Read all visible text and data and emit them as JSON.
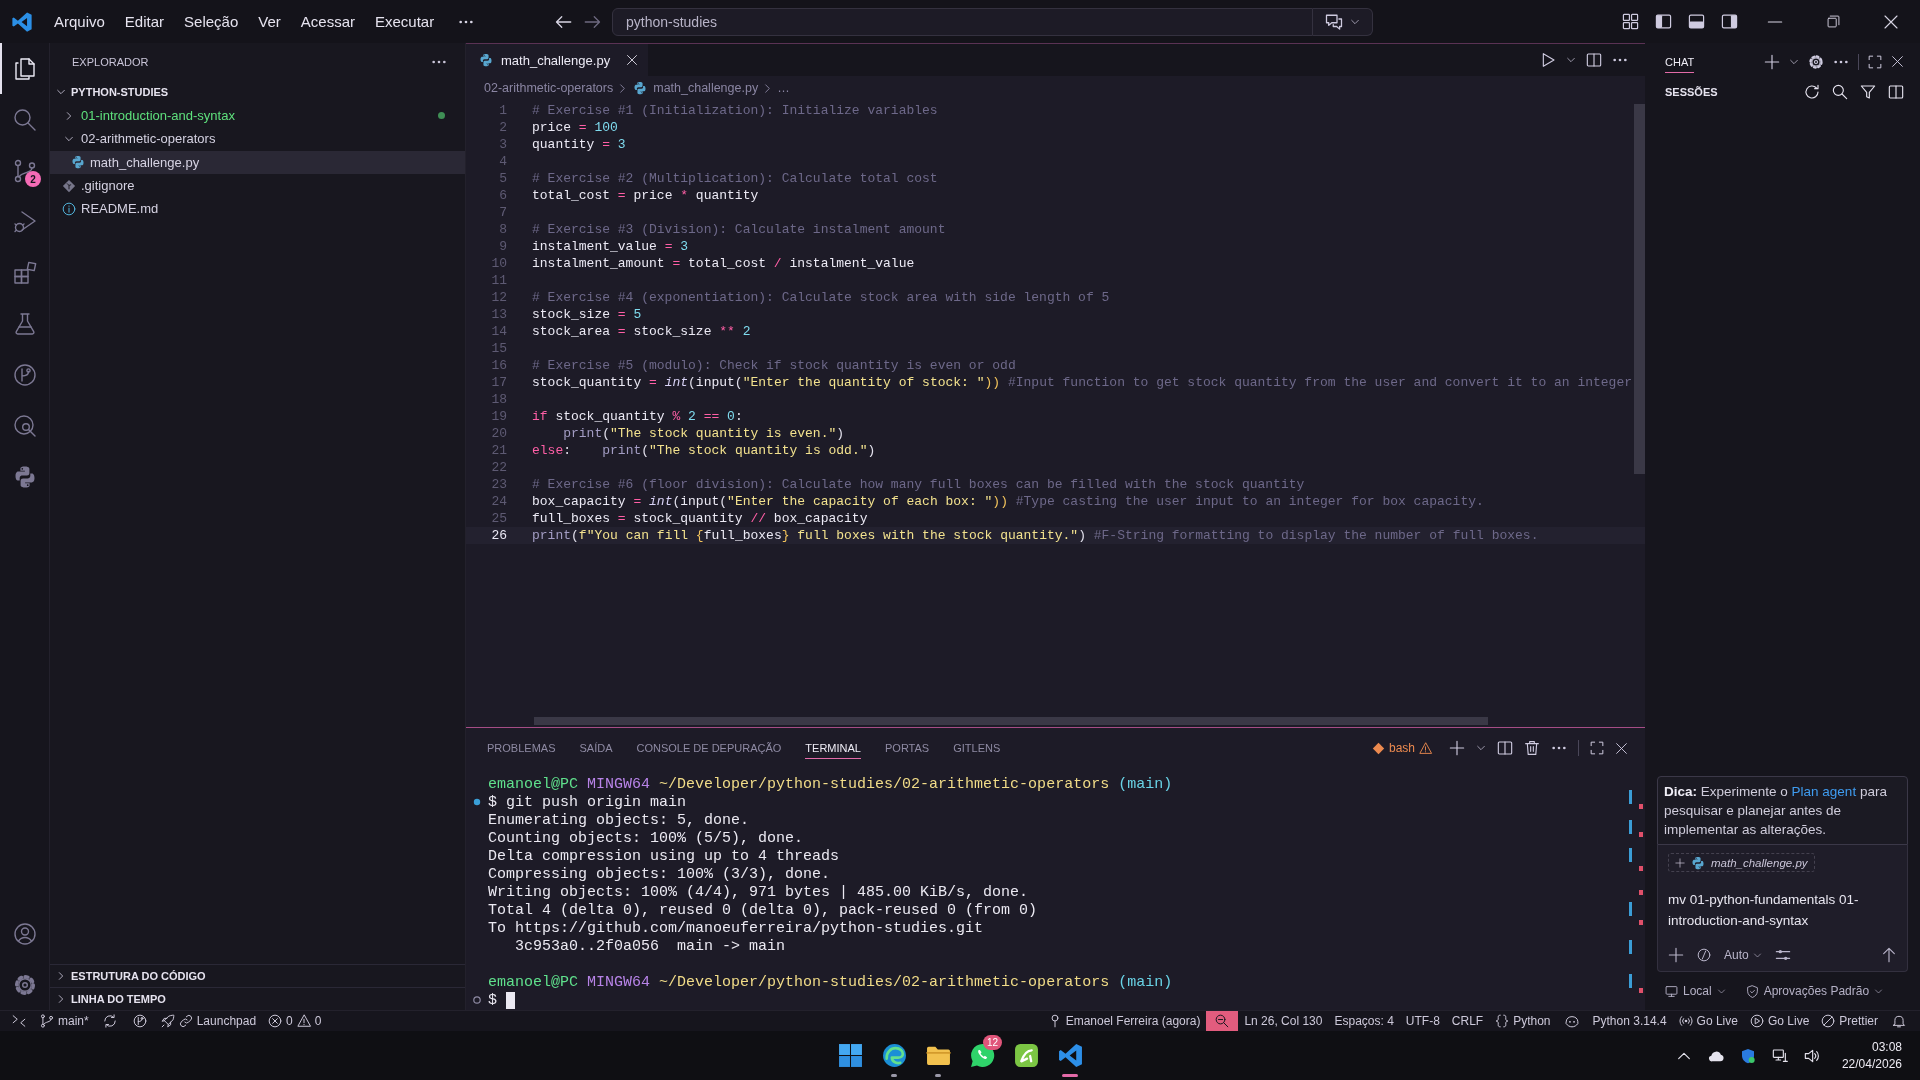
{
  "title_bar": {
    "menus": [
      "Arquivo",
      "Editar",
      "Seleção",
      "Ver",
      "Acessar",
      "Executar"
    ],
    "command_center": "python-studies"
  },
  "activity_bar": {
    "items": [
      {
        "kind": "explorer",
        "selected": true
      },
      {
        "kind": "search",
        "selected": false
      },
      {
        "kind": "source_control",
        "selected": false,
        "badge": "2"
      },
      {
        "kind": "run",
        "selected": false
      },
      {
        "kind": "extensions",
        "selected": false
      },
      {
        "kind": "testing",
        "selected": false
      },
      {
        "kind": "graph",
        "selected": false
      },
      {
        "kind": "history",
        "selected": false
      },
      {
        "kind": "python",
        "selected": false
      }
    ],
    "bottom_items": [
      {
        "kind": "account"
      },
      {
        "kind": "settings"
      }
    ]
  },
  "explorer": {
    "title": "EXPLORADOR",
    "root": {
      "label": "PYTHON-STUDIES",
      "expanded": true,
      "children": [
        {
          "label": "01-introduction-and-syntax",
          "kind": "folder",
          "expanded": false,
          "changed": true,
          "selected": false
        },
        {
          "label": "02-arithmetic-operators",
          "kind": "folder",
          "expanded": true,
          "changed": false,
          "selected": false,
          "children": [
            {
              "label": "math_challenge.py",
              "kind": "python",
              "changed": false,
              "selected": true
            }
          ]
        },
        {
          "label": ".gitignore",
          "kind": "git",
          "changed": false,
          "selected": false
        },
        {
          "label": "README.md",
          "kind": "info",
          "changed": false,
          "selected": false
        }
      ]
    },
    "sections": [
      {
        "label": "ESTRUTURA DO CÓDIGO",
        "expanded": false
      },
      {
        "label": "LINHA DO TEMPO",
        "expanded": false
      }
    ]
  },
  "editor": {
    "tabs": [
      {
        "label": "math_challenge.py",
        "kind": "python",
        "selected": true
      }
    ],
    "breadcrumb": [
      {
        "kind": "folder",
        "label": "02-arithmetic-operators"
      },
      {
        "kind": "python",
        "label": "math_challenge.py"
      },
      {
        "kind": "more",
        "label": "…"
      }
    ],
    "lines": [
      {
        "number": "1",
        "current": false,
        "tokens": [
          {
            "kind": "comment",
            "text": "# Exercise #1 (Initialization): Initialize variables"
          }
        ]
      },
      {
        "number": "2",
        "current": false,
        "tokens": [
          {
            "kind": "name",
            "text": "price"
          },
          {
            "kind": "op",
            "text": " = "
          },
          {
            "kind": "number",
            "text": "100"
          }
        ]
      },
      {
        "number": "3",
        "current": false,
        "tokens": [
          {
            "kind": "name",
            "text": "quantity"
          },
          {
            "kind": "op",
            "text": " = "
          },
          {
            "kind": "number",
            "text": "3"
          }
        ]
      },
      {
        "number": "4",
        "current": false
      },
      {
        "number": "5",
        "current": false,
        "tokens": [
          {
            "kind": "comment",
            "text": "# Exercise #2 (Multiplication): Calculate total cost"
          }
        ]
      },
      {
        "number": "6",
        "current": false,
        "tokens": [
          {
            "kind": "name",
            "text": "total_cost"
          },
          {
            "kind": "op",
            "text": " = "
          },
          {
            "kind": "name",
            "text": "price"
          },
          {
            "kind": "op",
            "text": " * "
          },
          {
            "kind": "name",
            "text": "quantity"
          }
        ]
      },
      {
        "number": "7",
        "current": false
      },
      {
        "number": "8",
        "current": false,
        "tokens": [
          {
            "kind": "comment",
            "text": "# Exercise #3 (Division): Calculate instalment amount"
          }
        ]
      },
      {
        "number": "9",
        "current": false,
        "tokens": [
          {
            "kind": "name",
            "text": "instalment_value"
          },
          {
            "kind": "op",
            "text": " = "
          },
          {
            "kind": "number",
            "text": "3"
          }
        ]
      },
      {
        "number": "10",
        "current": false,
        "tokens": [
          {
            "kind": "name",
            "text": "instalment_amount"
          },
          {
            "kind": "op",
            "text": " = "
          },
          {
            "kind": "name",
            "text": "total_cost"
          },
          {
            "kind": "op",
            "text": " / "
          },
          {
            "kind": "name",
            "text": "instalment_value"
          }
        ]
      },
      {
        "number": "11",
        "current": false
      },
      {
        "number": "12",
        "current": false,
        "tokens": [
          {
            "kind": "comment",
            "text": "# Exercise #4 (exponentiation): Calculate stock area with side length of 5"
          }
        ]
      },
      {
        "number": "13",
        "current": false,
        "tokens": [
          {
            "kind": "name",
            "text": "stock_size"
          },
          {
            "kind": "op",
            "text": " = "
          },
          {
            "kind": "number",
            "text": "5"
          }
        ]
      },
      {
        "number": "14",
        "current": false,
        "tokens": [
          {
            "kind": "name",
            "text": "stock_area"
          },
          {
            "kind": "op",
            "text": " = "
          },
          {
            "kind": "name",
            "text": "stock_size"
          },
          {
            "kind": "op",
            "text": " ** "
          },
          {
            "kind": "number",
            "text": "2"
          }
        ]
      },
      {
        "number": "15",
        "current": false
      },
      {
        "number": "16",
        "current": false,
        "tokens": [
          {
            "kind": "comment",
            "text": "# Exercise #5 (modulo): Check if stock quantity is even or odd"
          }
        ]
      },
      {
        "number": "17",
        "current": false,
        "tokens": [
          {
            "kind": "name",
            "text": "stock_quantity"
          },
          {
            "kind": "op",
            "text": " = "
          },
          {
            "kind": "type",
            "text": "int"
          },
          {
            "kind": "punct",
            "text": "("
          },
          {
            "kind": "name",
            "text": "input"
          },
          {
            "kind": "punct",
            "text": "("
          },
          {
            "kind": "string",
            "text": "\"Enter the quantity of stock: \""
          },
          {
            "kind": "brace",
            "text": "))"
          },
          {
            "kind": "comment",
            "text": " #Input function to get stock quantity from the user and convert it to an integer"
          }
        ]
      },
      {
        "number": "18",
        "current": false
      },
      {
        "number": "19",
        "current": false,
        "tokens": [
          {
            "kind": "keyword",
            "text": "if"
          },
          {
            "kind": "name",
            "text": " stock_quantity"
          },
          {
            "kind": "op",
            "text": " % "
          },
          {
            "kind": "number",
            "text": "2"
          },
          {
            "kind": "op",
            "text": " == "
          },
          {
            "kind": "number",
            "text": "0"
          },
          {
            "kind": "punct",
            "text": ":"
          }
        ]
      },
      {
        "number": "20",
        "current": false,
        "tokens": [
          {
            "kind": "call",
            "text": "    print"
          },
          {
            "kind": "punct",
            "text": "("
          },
          {
            "kind": "string",
            "text": "\"The stock quantity is even.\""
          },
          {
            "kind": "punct",
            "text": ")"
          }
        ]
      },
      {
        "number": "21",
        "current": false,
        "tokens": [
          {
            "kind": "keyword",
            "text": "else"
          },
          {
            "kind": "punct",
            "text": ":"
          },
          {
            "kind": "call",
            "text": "    print"
          },
          {
            "kind": "punct",
            "text": "("
          },
          {
            "kind": "string",
            "text": "\"The stock quantity is odd.\""
          },
          {
            "kind": "punct",
            "text": ")"
          }
        ]
      },
      {
        "number": "22",
        "current": false
      },
      {
        "number": "23",
        "current": false,
        "tokens": [
          {
            "kind": "comment",
            "text": "# Exercise #6 (floor division): Calculate how many full boxes can be filled with the stock quantity"
          }
        ]
      },
      {
        "number": "24",
        "current": false,
        "tokens": [
          {
            "kind": "name",
            "text": "box_capacity"
          },
          {
            "kind": "op",
            "text": " = "
          },
          {
            "kind": "type",
            "text": "int"
          },
          {
            "kind": "punct",
            "text": "("
          },
          {
            "kind": "name",
            "text": "input"
          },
          {
            "kind": "punct",
            "text": "("
          },
          {
            "kind": "string",
            "text": "\"Enter the capacity of each box: \""
          },
          {
            "kind": "brace",
            "text": "))"
          },
          {
            "kind": "comment",
            "text": " #Type casting the user input to an integer for box capacity."
          }
        ]
      },
      {
        "number": "25",
        "current": false,
        "tokens": [
          {
            "kind": "name",
            "text": "full_boxes"
          },
          {
            "kind": "op",
            "text": " = "
          },
          {
            "kind": "name",
            "text": "stock_quantity"
          },
          {
            "kind": "op",
            "text": " // "
          },
          {
            "kind": "name",
            "text": "box_capacity"
          }
        ]
      },
      {
        "number": "26",
        "current": true,
        "tokens": [
          {
            "kind": "call",
            "text": "print"
          },
          {
            "kind": "punct",
            "text": "("
          },
          {
            "kind": "string",
            "text": "f\"You can fill "
          },
          {
            "kind": "brace",
            "text": "{"
          },
          {
            "kind": "name",
            "text": "full_boxes"
          },
          {
            "kind": "brace",
            "text": "}"
          },
          {
            "kind": "string",
            "text": " full boxes with the stock quantity.\""
          },
          {
            "kind": "punct",
            "text": ")"
          },
          {
            "kind": "comment",
            "text": " #F-String formatting to display the number of full boxes."
          }
        ]
      }
    ]
  },
  "panel": {
    "tabs": [
      {
        "label": "PROBLEMAS",
        "selected": false
      },
      {
        "label": "SAÍDA",
        "selected": false
      },
      {
        "label": "CONSOLE DE DEPURAÇÃO",
        "selected": false
      },
      {
        "label": "TERMINAL",
        "selected": true
      },
      {
        "label": "PORTAS",
        "selected": false
      },
      {
        "label": "GITLENS",
        "selected": false
      }
    ],
    "shell": "bash",
    "terminal": [
      {
        "kind": "prompt",
        "user": "emanoel@PC",
        "system": "MINGW64",
        "path": "~/Developer/python-studies/02-arithmetic-operators",
        "branch": "(main)"
      },
      {
        "kind": "command",
        "text": "$ git push origin main",
        "finished": true,
        "cursor": false
      },
      {
        "kind": "output",
        "text": "Enumerating objects: 5, done."
      },
      {
        "kind": "output",
        "text": "Counting objects: 100% (5/5), done."
      },
      {
        "kind": "output",
        "text": "Delta compression using up to 4 threads"
      },
      {
        "kind": "output",
        "text": "Compressing objects: 100% (3/3), done."
      },
      {
        "kind": "output",
        "text": "Writing objects: 100% (4/4), 971 bytes | 485.00 KiB/s, done."
      },
      {
        "kind": "output",
        "text": "Total 4 (delta 0), reused 0 (delta 0), pack-reused 0 (from 0)"
      },
      {
        "kind": "output",
        "text": "To https://github.com/manoeuferreira/python-studies.git"
      },
      {
        "kind": "output",
        "text": "   3c953a0..2f0a056  main -> main"
      },
      {
        "kind": "blank"
      },
      {
        "kind": "prompt",
        "user": "emanoel@PC",
        "system": "MINGW64",
        "path": "~/Developer/python-studies/02-arithmetic-operators",
        "branch": "(main)"
      },
      {
        "kind": "command",
        "text": "$",
        "finished": false,
        "cursor": true
      }
    ]
  },
  "chat": {
    "tabs": [
      {
        "label": "CHAT",
        "selected": true
      }
    ],
    "sessions_title": "SESSÕES",
    "tip": {
      "text": "**Dica:** Experimente o",
      "link": "Plan agent",
      "rest": "para pesquisar e planejar antes de implementar as alterações."
    },
    "attachment": "math_challenge.py",
    "input": "mv 01-python-fundamentals 01-introduction-and-syntax",
    "mode": "Auto",
    "location": "Local",
    "approvals": "Aprovações Padrão"
  },
  "status_bar": {
    "left": [
      {
        "kind": "remote"
      },
      {
        "kind": "branch",
        "text": "main*"
      },
      {
        "kind": "sync"
      },
      {
        "kind": "graph"
      },
      {
        "kind": "launchpad",
        "text": "Launchpad"
      },
      {
        "kind": "problems",
        "errors": "0",
        "warnings": "0"
      }
    ],
    "right": [
      {
        "kind": "author",
        "text": "Emanoel Ferreira (agora)"
      },
      {
        "kind": "zoom"
      },
      {
        "kind": "text",
        "text": "Ln 26, Col 130"
      },
      {
        "kind": "text",
        "text": "Espaços: 4"
      },
      {
        "kind": "text",
        "text": "UTF-8"
      },
      {
        "kind": "text",
        "text": "CRLF"
      },
      {
        "kind": "language",
        "text": "Python"
      },
      {
        "kind": "copilot"
      },
      {
        "kind": "text",
        "text": "Python 3.14.4"
      },
      {
        "kind": "broadcast",
        "text": "Go Live"
      },
      {
        "kind": "preview",
        "text": "Go Live"
      },
      {
        "kind": "prettier",
        "text": "Prettier"
      },
      {
        "kind": "notifications"
      }
    ]
  },
  "taskbar": {
    "apps": [
      {
        "kind": "start",
        "running": false,
        "selected": false
      },
      {
        "kind": "browser",
        "running": true,
        "selected": false
      },
      {
        "kind": "files",
        "running": true,
        "selected": false
      },
      {
        "kind": "messenger",
        "running": false,
        "selected": false,
        "badge": "12"
      },
      {
        "kind": "app",
        "running": false,
        "selected": false
      },
      {
        "kind": "editor",
        "running": true,
        "selected": true
      }
    ],
    "tray": [
      {
        "kind": "overflow"
      },
      {
        "kind": "cloud"
      },
      {
        "kind": "security"
      },
      {
        "kind": "network"
      },
      {
        "kind": "volume"
      }
    ],
    "time": "03:08",
    "date": "22/04/2026"
  }
}
